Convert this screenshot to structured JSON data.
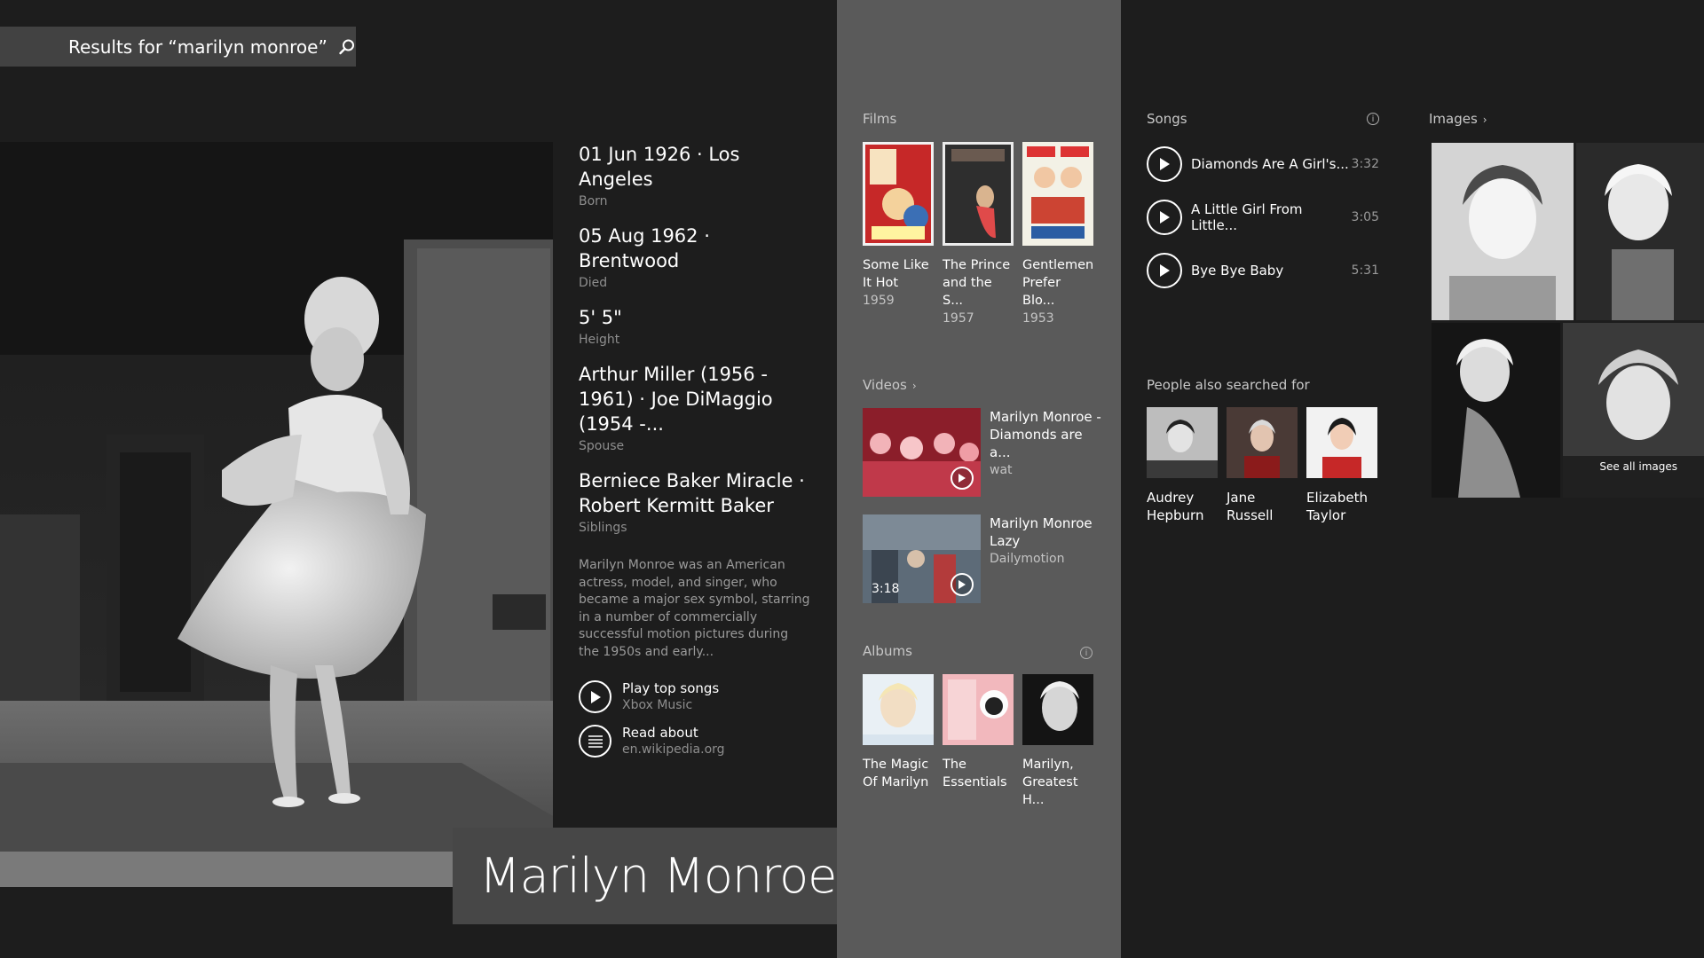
{
  "search": {
    "label": "Results for “marilyn monroe”"
  },
  "entity": {
    "name": "Marilyn Monroe",
    "facts": [
      {
        "value": "01 Jun 1926 · Los Angeles",
        "label": "Born"
      },
      {
        "value": "05 Aug 1962 · Brentwood",
        "label": "Died"
      },
      {
        "value": "5' 5\"",
        "label": "Height"
      },
      {
        "value": "Arthur Miller (1956 - 1961) · Joe DiMaggio (1954 -...",
        "label": "Spouse"
      },
      {
        "value": "Berniece Baker Miracle · Robert Kermitt Baker",
        "label": "Siblings"
      }
    ],
    "description": "Marilyn Monroe was an American actress, model, and singer, who became a major sex symbol, starring in a number of commercially successful motion pictures during the 1950s and early...",
    "actions": [
      {
        "title": "Play top songs",
        "subtitle": "Xbox Music",
        "icon": "play-icon"
      },
      {
        "title": "Read about",
        "subtitle": "en.wikipedia.org",
        "icon": "article-icon"
      }
    ]
  },
  "films": {
    "title": "Films",
    "items": [
      {
        "title": "Some Like It Hot",
        "year": "1959"
      },
      {
        "title": "The Prince and the S...",
        "year": "1957"
      },
      {
        "title": "Gentlemen Prefer Blo...",
        "year": "1953"
      }
    ]
  },
  "videos": {
    "title": "Videos",
    "items": [
      {
        "title": "Marilyn Monroe - Diamonds are a...",
        "source": "wat",
        "duration": ""
      },
      {
        "title": "Marilyn Monroe Lazy",
        "source": "Dailymotion",
        "duration": "3:18"
      }
    ]
  },
  "albums": {
    "title": "Albums",
    "items": [
      {
        "title": "The Magic Of Marilyn"
      },
      {
        "title": "The Essentials"
      },
      {
        "title": "Marilyn, Greatest H..."
      }
    ]
  },
  "songs": {
    "title": "Songs",
    "items": [
      {
        "title": "Diamonds Are A Girl's...",
        "duration": "3:32"
      },
      {
        "title": "A Little Girl From Little...",
        "duration": "3:05"
      },
      {
        "title": "Bye Bye Baby",
        "duration": "5:31"
      }
    ]
  },
  "people": {
    "title": "People also searched for",
    "items": [
      {
        "name": "Audrey Hepburn"
      },
      {
        "name": "Jane Russell"
      },
      {
        "name": "Elizabeth Taylor"
      }
    ]
  },
  "images": {
    "title": "Images",
    "see_all": "See all images"
  },
  "colors": {
    "background": "#1d1d1d",
    "mid_panel": "#5a5a5a",
    "search_bar": "#424242",
    "name_box": "#474747"
  }
}
